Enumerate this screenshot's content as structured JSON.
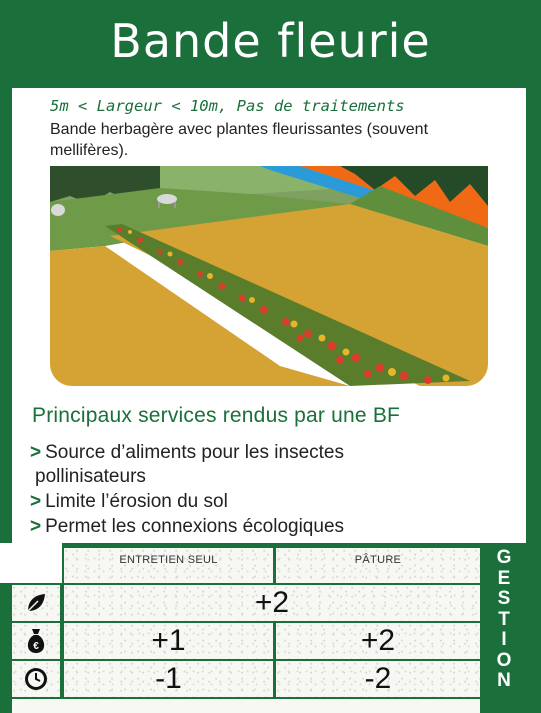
{
  "card": {
    "title": "Bande fleurie",
    "subtitle": "5m < Largeur < 10m, Pas de traitements",
    "description": "Bande herbagère avec plantes fleurissantes (souvent mellifères)."
  },
  "services": {
    "heading": "Principaux services rendus par une BF",
    "items": [
      {
        "line1": "Source d’aliments pour les insectes",
        "line2": "pollinisateurs"
      },
      {
        "line1": "Limite l’érosion du sol",
        "line2": ""
      },
      {
        "line1": "Permet les connexions écologiques",
        "line2": ""
      }
    ]
  },
  "table": {
    "col_headers": [
      "ENTRETIEN SEUL",
      "PÂTURE"
    ],
    "rows": [
      {
        "icon": "leaf-icon",
        "merged": "+2"
      },
      {
        "icon": "money-bag-euro-icon",
        "values": [
          "+1",
          "+2"
        ]
      },
      {
        "icon": "clock-icon",
        "values": [
          "-1",
          "-2"
        ]
      }
    ],
    "side_label": "GESTION"
  },
  "colors": {
    "brand_green": "#1a6f3a",
    "field_yellow": "#d4a334",
    "grass_green": "#6f9a48",
    "water_blue": "#2a9bd8",
    "soil_orange": "#f06a16"
  }
}
